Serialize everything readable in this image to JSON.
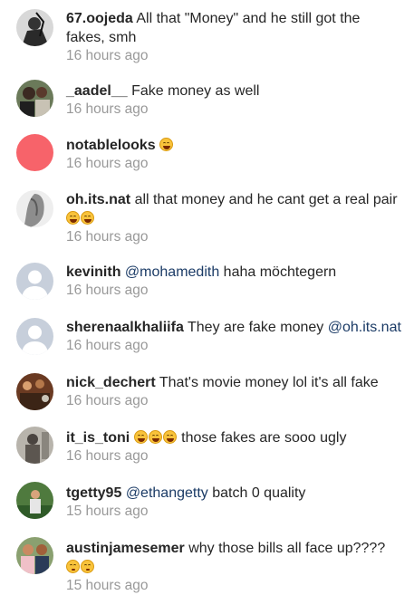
{
  "comments": [
    {
      "username": "67.oojeda",
      "text": "All that \"Money\" and he still got the fakes, smh",
      "time": "16 hours ago",
      "avatar": "photo-dark"
    },
    {
      "username": "_aadel__",
      "text": "Fake money as well",
      "time": "16 hours ago",
      "avatar": "photo-people"
    },
    {
      "username": "notablelooks",
      "text": "",
      "emojis": [
        "tears-of-joy"
      ],
      "time": "16 hours ago",
      "avatar": "red-circle"
    },
    {
      "username": "oh.its.nat",
      "text": "all that money and he cant get a real pair",
      "emojis_line2": [
        "tears-of-joy",
        "tears-of-joy"
      ],
      "time": "16 hours ago",
      "avatar": "photo-bw"
    },
    {
      "username": "kevinith",
      "mention": "@mohamedith",
      "text": "haha möchtegern",
      "time": "16 hours ago",
      "avatar": "default-user"
    },
    {
      "username": "sherenaalkhaliifa",
      "text": "They are fake money",
      "mention_after": "@oh.its.nat",
      "time": "16 hours ago",
      "avatar": "default-user"
    },
    {
      "username": "nick_dechert",
      "text": "That's movie money lol it's all fake",
      "time": "16 hours ago",
      "avatar": "photo-crowd"
    },
    {
      "username": "it_is_toni",
      "emojis": [
        "tears-of-joy",
        "tears-of-joy",
        "tears-of-joy"
      ],
      "text": "those fakes are sooo ugly",
      "time": "16 hours ago",
      "avatar": "photo-gray"
    },
    {
      "username": "tgetty95",
      "mention": "@ethangetty",
      "text": "batch 0 quality",
      "time": "15 hours ago",
      "avatar": "photo-outdoor"
    },
    {
      "username": "austinjamesemer",
      "text": "why those bills all face up????",
      "emojis_line2": [
        "thinking-face",
        "thinking-face"
      ],
      "time": "15 hours ago",
      "avatar": "photo-group"
    }
  ],
  "colors": {
    "text": "#262626",
    "time": "#999999",
    "mention": "#1b3b66",
    "red_avatar": "#f7636a",
    "default_avatar": "#c7cfdb"
  }
}
